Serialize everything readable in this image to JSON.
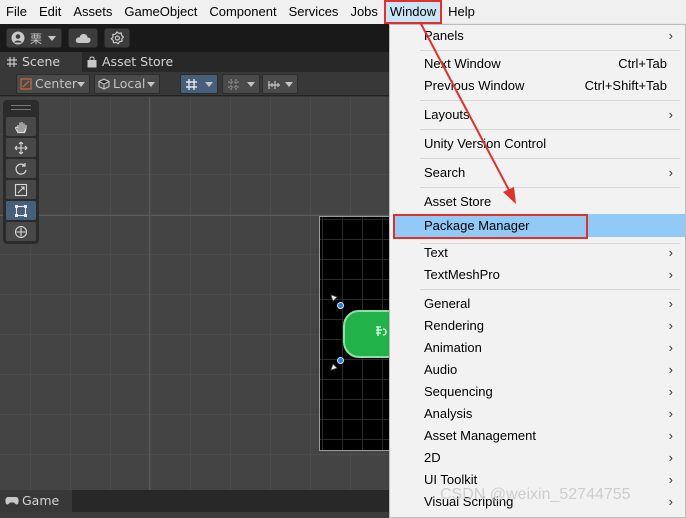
{
  "menubar": {
    "items": [
      "File",
      "Edit",
      "Assets",
      "GameObject",
      "Component",
      "Services",
      "Jobs",
      "Window",
      "Help"
    ]
  },
  "toolbar": {
    "account_label": "栗"
  },
  "tabs": {
    "scene": "Scene",
    "asset_store": "Asset Store",
    "game": "Game"
  },
  "scene_toolbar": {
    "pivot": "Center",
    "space": "Local"
  },
  "window_menu": {
    "items": [
      {
        "label": "Panels",
        "submenu": true
      },
      {
        "label": "Next Window",
        "shortcut": "Ctrl+Tab"
      },
      {
        "label": "Previous Window",
        "shortcut": "Ctrl+Shift+Tab"
      },
      {
        "label": "Layouts",
        "submenu": true
      },
      {
        "label": "Unity Version Control"
      },
      {
        "label": "Search",
        "submenu": true
      },
      {
        "label": "Asset Store"
      },
      {
        "label": "Package Manager",
        "highlighted": true
      },
      {
        "label": "Text",
        "submenu": true
      },
      {
        "label": "TextMeshPro",
        "submenu": true
      },
      {
        "label": "General",
        "submenu": true
      },
      {
        "label": "Rendering",
        "submenu": true
      },
      {
        "label": "Animation",
        "submenu": true
      },
      {
        "label": "Audio",
        "submenu": true
      },
      {
        "label": "Sequencing",
        "submenu": true
      },
      {
        "label": "Analysis",
        "submenu": true
      },
      {
        "label": "Asset Management",
        "submenu": true
      },
      {
        "label": "2D",
        "submenu": true
      },
      {
        "label": "UI Toolkit",
        "submenu": true
      },
      {
        "label": "Visual Scripting",
        "submenu": true
      }
    ]
  },
  "watermark": "CSDN @weixin_52744755",
  "colors": {
    "highlight": "#91c9f7",
    "annotation_red": "#e0322a"
  }
}
